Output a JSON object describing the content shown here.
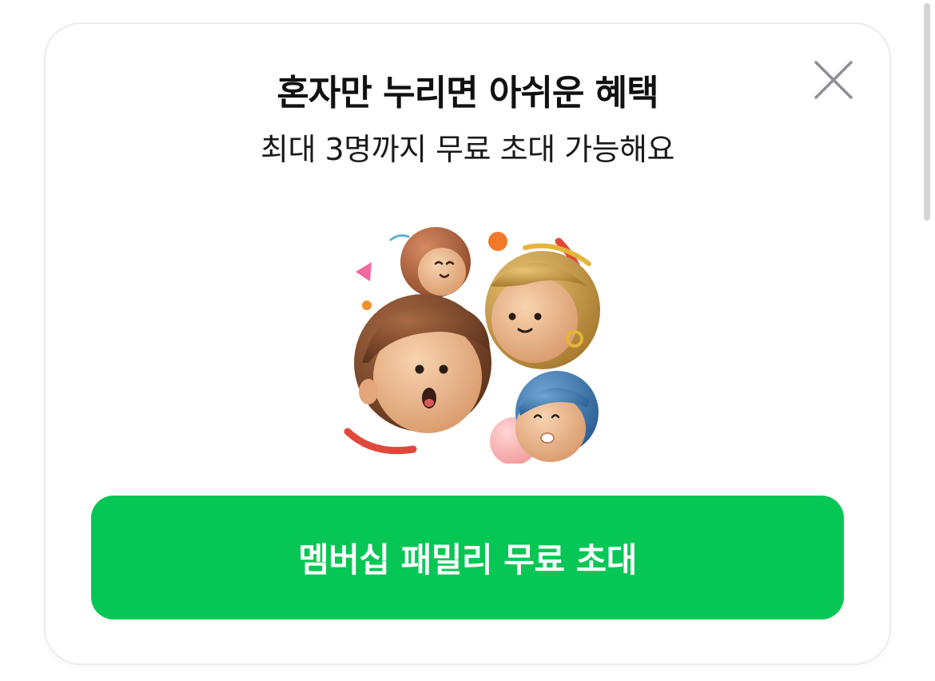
{
  "dialog": {
    "title": "혼자만 누리면 아쉬운 혜택",
    "subtitle": "최대 3명까지 무료 초대 가능해요",
    "close_icon": "close-icon",
    "illustration_icon": "family-faces-illustration",
    "cta_label": "멤버십 패밀리 무료 초대"
  },
  "colors": {
    "accent": "#06c755",
    "title_text": "#111111",
    "close_icon": "#8e8e96"
  }
}
